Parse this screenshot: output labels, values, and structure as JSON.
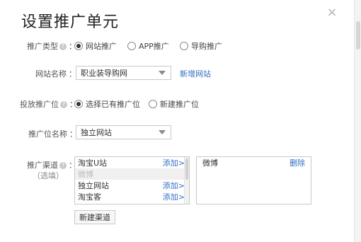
{
  "dialog": {
    "title": "设置推广单元",
    "close_glyph": "×"
  },
  "promo_type": {
    "label": "推广类型",
    "help": "?",
    "colon": "：",
    "options": [
      "网站推广",
      "APP推广",
      "导购推广"
    ],
    "selected": "网站推广"
  },
  "site_name": {
    "label": "网站名称",
    "colon": "：",
    "value": "职业装导购网",
    "add_link": "新增网站"
  },
  "placement": {
    "label": "投放推广位",
    "help": "?",
    "colon": "：",
    "options": [
      "选择已有推广位",
      "新建推广位"
    ],
    "selected": "选择已有推广位"
  },
  "placement_name": {
    "label": "推广位名称",
    "colon": "：",
    "value": "独立网站"
  },
  "channel": {
    "label": "推广渠道",
    "help": "?",
    "colon": "：",
    "optional": "（选填）",
    "available": [
      {
        "name": "淘宝U站",
        "action": "添加>",
        "disabled": false
      },
      {
        "name": "微博",
        "action": "",
        "disabled": true
      },
      {
        "name": "独立网站",
        "action": "添加>",
        "disabled": false
      },
      {
        "name": "淘宝客",
        "action": "添加>",
        "disabled": false
      }
    ],
    "selected": [
      {
        "name": "微博",
        "action": "删除"
      }
    ],
    "new_button": "新建渠道"
  }
}
